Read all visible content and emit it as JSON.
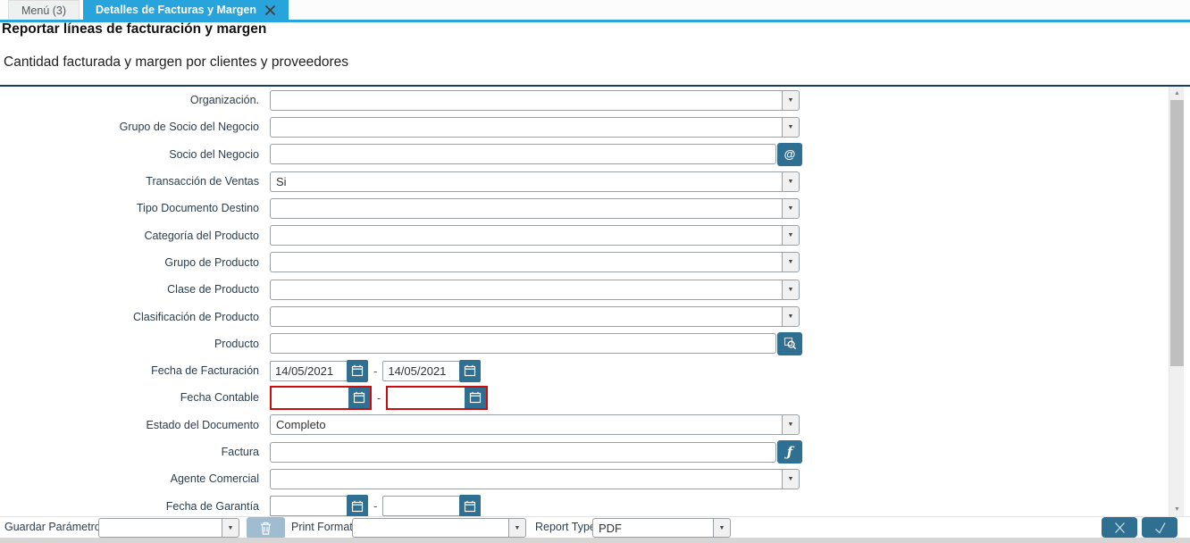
{
  "tabs": {
    "menu": {
      "label": "Menú (3)"
    },
    "active": {
      "label": "Detalles de Facturas y Margen"
    }
  },
  "header": {
    "title": "Reportar líneas de facturación y margen",
    "subtitle": "Cantidad facturada y margen por clientes y proveedores"
  },
  "form": {
    "date_separator": "-",
    "fields": [
      {
        "label": "Organización.",
        "type": "combo",
        "value": ""
      },
      {
        "label": "Grupo de Socio del Negocio",
        "type": "combo",
        "value": ""
      },
      {
        "label": "Socio del Negocio",
        "type": "search",
        "value": "",
        "icon": "@"
      },
      {
        "label": "Transacción de Ventas",
        "type": "combo",
        "value": "Si"
      },
      {
        "label": "Tipo Documento Destino",
        "type": "combo",
        "value": ""
      },
      {
        "label": "Categoría del Producto",
        "type": "combo",
        "value": ""
      },
      {
        "label": "Grupo de Producto",
        "type": "combo",
        "value": ""
      },
      {
        "label": "Clase de Producto",
        "type": "combo",
        "value": ""
      },
      {
        "label": "Clasificación de Producto",
        "type": "combo",
        "value": ""
      },
      {
        "label": "Producto",
        "type": "search",
        "value": "",
        "icon": "product-search"
      },
      {
        "label": "Fecha de Facturación",
        "type": "daterange",
        "from": "14/05/2021",
        "to": "14/05/2021",
        "mandatory": false
      },
      {
        "label": "Fecha Contable",
        "type": "daterange",
        "from": "",
        "to": "",
        "mandatory": true
      },
      {
        "label": "Estado del Documento",
        "type": "combo",
        "value": "Completo"
      },
      {
        "label": "Factura",
        "type": "search",
        "value": "",
        "icon": "ƒ"
      },
      {
        "label": "Agente Comercial",
        "type": "combo",
        "value": ""
      },
      {
        "label": "Fecha de Garantía",
        "type": "daterange",
        "from": "",
        "to": "",
        "mandatory": false
      }
    ]
  },
  "footer": {
    "save_param": {
      "label": "Guardar Parámetro",
      "value": ""
    },
    "print_format": {
      "label": "Print Format",
      "value": ""
    },
    "report_type": {
      "label": "Report Type",
      "value": "PDF"
    }
  },
  "icons": {
    "combo_arrow": "▼",
    "scroll_up": "▲",
    "scroll_down": "▼",
    "bpartner_glyph": "@",
    "invoice_glyph": "ƒ"
  },
  "colors": {
    "tab_active": "#28a4dc",
    "navy_rule": "#1d3a5f",
    "accent_button": "#2f6f92",
    "mandatory_border": "#cf0c0c",
    "trash_button": "#9fbcd1"
  }
}
